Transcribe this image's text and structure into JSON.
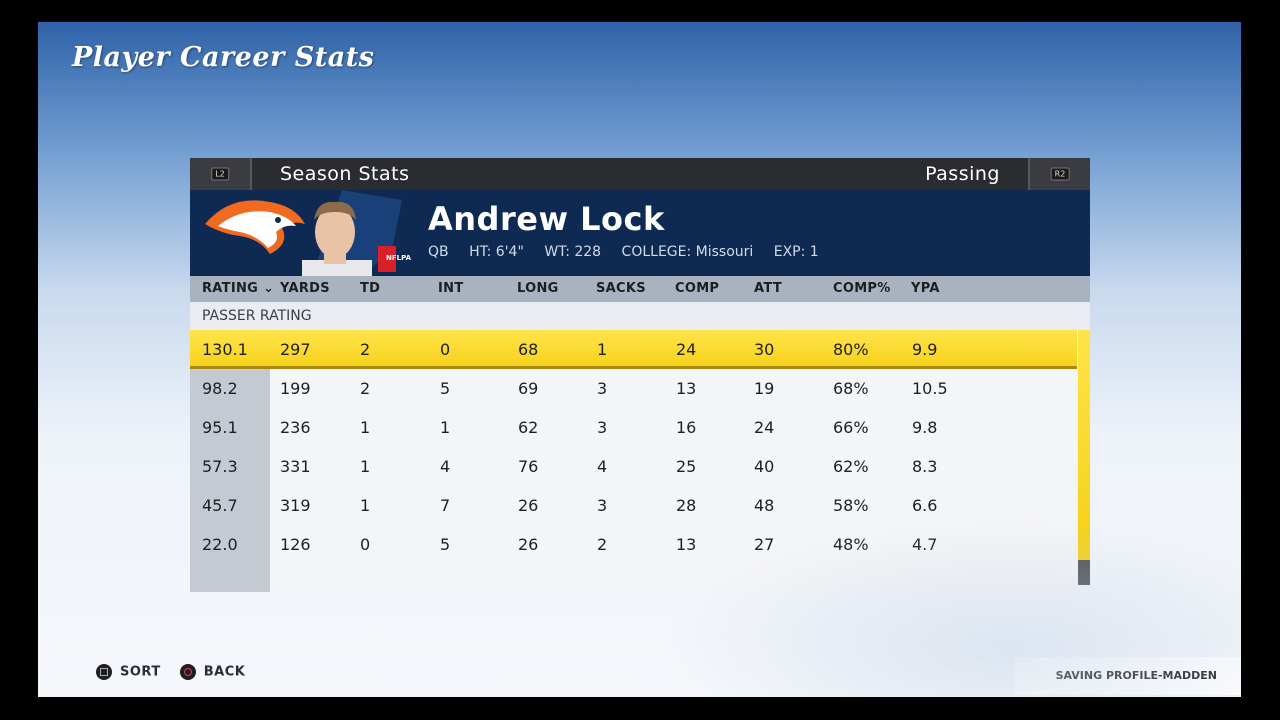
{
  "page_title": "Player Career Stats",
  "tabs": {
    "left_button": "L2",
    "section": "Season Stats",
    "category": "Passing",
    "right_button": "R2"
  },
  "player": {
    "name": "Andrew Lock",
    "position": "QB",
    "height": "HT: 6'4\"",
    "weight": "WT: 228",
    "college": "COLLEGE: Missouri",
    "experience": "EXP: 1",
    "badge": "NFLPA"
  },
  "columns": [
    "RATING",
    "YARDS",
    "TD",
    "INT",
    "LONG",
    "SACKS",
    "COMP",
    "ATT",
    "COMP%",
    "YPA"
  ],
  "sort_label": "PASSER RATING",
  "rows": [
    [
      "130.1",
      "297",
      "2",
      "0",
      "68",
      "1",
      "24",
      "30",
      "80%",
      "9.9"
    ],
    [
      "98.2",
      "199",
      "2",
      "5",
      "69",
      "3",
      "13",
      "19",
      "68%",
      "10.5"
    ],
    [
      "95.1",
      "236",
      "1",
      "1",
      "62",
      "3",
      "16",
      "24",
      "66%",
      "9.8"
    ],
    [
      "57.3",
      "331",
      "1",
      "4",
      "76",
      "4",
      "25",
      "40",
      "62%",
      "8.3"
    ],
    [
      "45.7",
      "319",
      "1",
      "7",
      "26",
      "3",
      "28",
      "48",
      "58%",
      "6.6"
    ],
    [
      "22.0",
      "126",
      "0",
      "5",
      "26",
      "2",
      "13",
      "27",
      "48%",
      "4.7"
    ]
  ],
  "footer": {
    "sort": "SORT",
    "back": "BACK",
    "status": "SAVING PROFILE-MADDEN"
  },
  "colors": {
    "highlight": "#f7d21d",
    "header_bg": "#0e2a52",
    "team_orange": "#f06a1f"
  }
}
